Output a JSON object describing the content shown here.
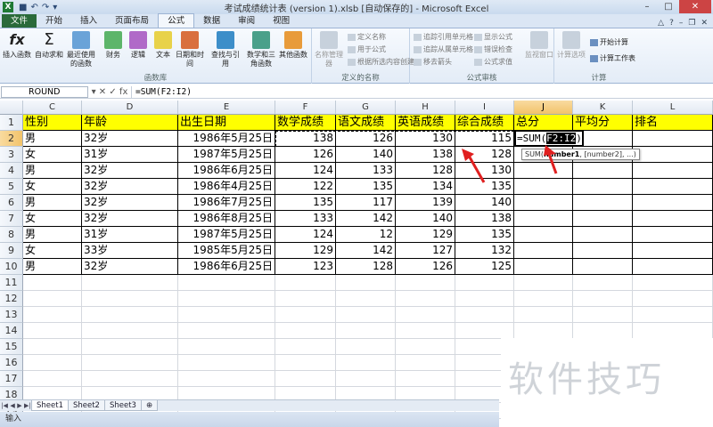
{
  "window": {
    "title": "考试成绩统计表 (version 1).xlsb [自动保存的] - Microsoft Excel",
    "logo": "X"
  },
  "tabs": [
    "文件",
    "开始",
    "插入",
    "页面布局",
    "公式",
    "数据",
    "审阅",
    "视图"
  ],
  "active_tab": "公式",
  "ribbon": {
    "function_library": {
      "label": "函数库",
      "buttons": [
        "插入函数",
        "自动求和",
        "最近使用的函数",
        "财务",
        "逻辑",
        "文本",
        "日期和时间",
        "查找与引用",
        "数学和三角函数",
        "其他函数"
      ]
    },
    "defined_names": {
      "label": "定义的名称",
      "big": "名称管理器",
      "small": [
        "定义名称",
        "用于公式",
        "根据所选内容创建"
      ]
    },
    "formula_auditing": {
      "label": "公式审核",
      "small": [
        "追踪引用单元格",
        "显示公式",
        "追踪从属单元格",
        "错误检查",
        "移去箭头",
        "公式求值"
      ],
      "big": "监视窗口"
    },
    "calculation": {
      "label": "计算",
      "big": "计算选项",
      "small": [
        "开始计算",
        "计算工作表"
      ]
    }
  },
  "formula_bar": {
    "name_box": "ROUND",
    "icons": "▾ ✕ ✓ fx",
    "formula": "=SUM(F2:I2)"
  },
  "columns": [
    "C",
    "D",
    "E",
    "F",
    "G",
    "H",
    "I",
    "J",
    "K",
    "L"
  ],
  "selected_column": "J",
  "rows": [
    "1",
    "2",
    "3",
    "4",
    "5",
    "6",
    "7",
    "8",
    "9",
    "10",
    "11",
    "12",
    "13",
    "14",
    "15",
    "16",
    "17",
    "18",
    "19",
    "20"
  ],
  "selected_row": "2",
  "headers": [
    "性别",
    "年龄",
    "出生日期",
    "数学成绩",
    "语文成绩",
    "英语成绩",
    "综合成绩",
    "总分",
    "平均分",
    "排名"
  ],
  "data": [
    [
      "男",
      "32岁",
      "1986年5月25日",
      "138",
      "126",
      "130",
      "115"
    ],
    [
      "女",
      "31岁",
      "1987年5月25日",
      "126",
      "140",
      "138",
      "128"
    ],
    [
      "男",
      "32岁",
      "1986年6月25日",
      "124",
      "133",
      "128",
      "130"
    ],
    [
      "女",
      "32岁",
      "1986年4月25日",
      "122",
      "135",
      "134",
      "135"
    ],
    [
      "男",
      "32岁",
      "1986年7月25日",
      "135",
      "117",
      "139",
      "140"
    ],
    [
      "女",
      "32岁",
      "1986年8月25日",
      "133",
      "142",
      "140",
      "138"
    ],
    [
      "男",
      "31岁",
      "1987年5月25日",
      "124",
      "12",
      "129",
      "135"
    ],
    [
      "女",
      "33岁",
      "1985年5月25日",
      "129",
      "142",
      "127",
      "132"
    ],
    [
      "男",
      "32岁",
      "1986年6月25日",
      "123",
      "128",
      "126",
      "125"
    ]
  ],
  "edit_cell": {
    "prefix": "=SUM(",
    "range": "F2:I2",
    "suffix": ")"
  },
  "tooltip": {
    "func": "SUM(",
    "arg1": "number1",
    "rest": ", [number2], ...)"
  },
  "sheets": [
    "Sheet1",
    "Sheet2",
    "Sheet3"
  ],
  "active_sheet": "Sheet1",
  "status": "输入",
  "watermark": "软件技巧",
  "colors": {
    "header_fill": "#ffff00",
    "arrow": "#e02020"
  }
}
